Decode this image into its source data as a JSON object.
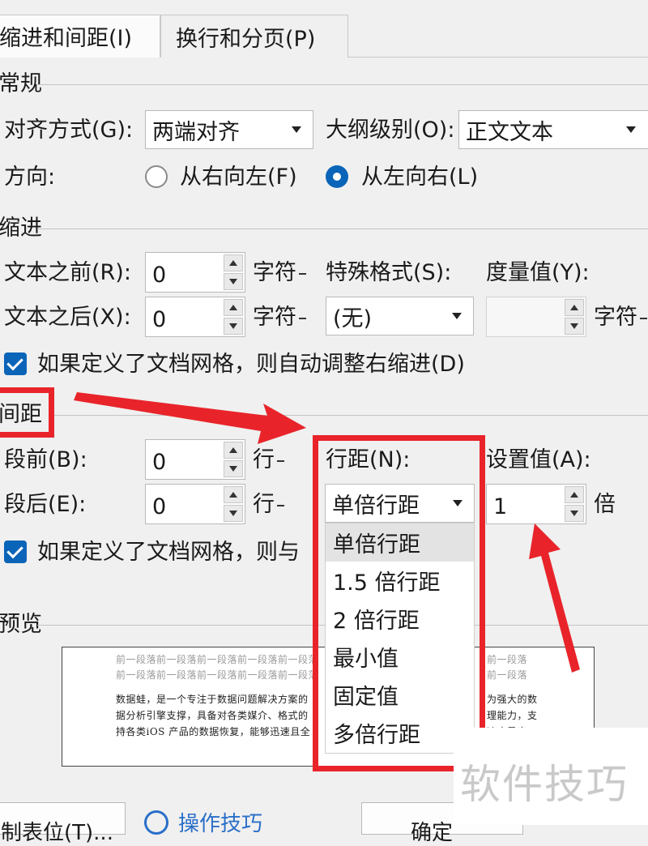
{
  "tabs": [
    {
      "label": "缩进和间距(I)",
      "active": true
    },
    {
      "label": "换行和分页(P)",
      "active": false
    }
  ],
  "general": {
    "heading": "常规",
    "alignment_label": "对齐方式(G):",
    "alignment_value": "两端对齐",
    "outline_label": "大纲级别(O):",
    "outline_value": "正文文本",
    "direction_label": "方向:",
    "rtl_label": "从右向左(F)",
    "ltr_label": "从左向右(L)"
  },
  "indent": {
    "heading": "缩进",
    "before_label": "文本之前(R):",
    "before_value": "0",
    "before_unit": "字符",
    "after_label": "文本之后(X):",
    "after_value": "0",
    "after_unit": "字符",
    "special_label": "特殊格式(S):",
    "special_value": "(无)",
    "measure_label": "度量值(Y):",
    "measure_value": "",
    "measure_unit": "字符",
    "auto_adjust_label": "如果定义了文档网格，则自动调整右缩进(D)",
    "auto_adjust_checked": true
  },
  "spacing": {
    "heading": "间距",
    "before_label": "段前(B):",
    "before_value": "0",
    "before_unit": "行",
    "after_label": "段后(E):",
    "after_value": "0",
    "after_unit": "行",
    "line_spacing_label": "行距(N):",
    "line_spacing_value": "单倍行距",
    "set_value_label": "设置值(A):",
    "set_value": "1",
    "set_value_unit": "倍",
    "grid_label": "如果定义了文档网格，则与",
    "grid_checked": true,
    "options": [
      "单倍行距",
      "1.5 倍行距",
      "2 倍行距",
      "最小值",
      "固定值",
      "多倍行距"
    ],
    "selected_option": "单倍行距"
  },
  "preview": {
    "heading": "预览",
    "lines_left": [
      "前一段落前一段落前一段落前一段落前一段落",
      "前一段落前一段落前一段落前一段落前一段落",
      "数据蛙，是一个专注于数据问题解决方案的",
      "据分析引擎支撑，具备对各类媒介、格式的",
      "持各类iOS 产品的数据恢复，能够迅速且全"
    ],
    "lines_right": [
      "前一段落",
      "前一段落",
      "为强大的数",
      "理能力，支",
      "速度导出。"
    ]
  },
  "footer": {
    "tabs_button": "制表位(T)...",
    "tips_link": "操作技巧",
    "ok_button": "确定"
  },
  "watermark": "软件技巧",
  "colors": {
    "accent": "#0a64b8",
    "highlight_red": "#e8242a",
    "dialog_bg": "#f0f0f0"
  }
}
